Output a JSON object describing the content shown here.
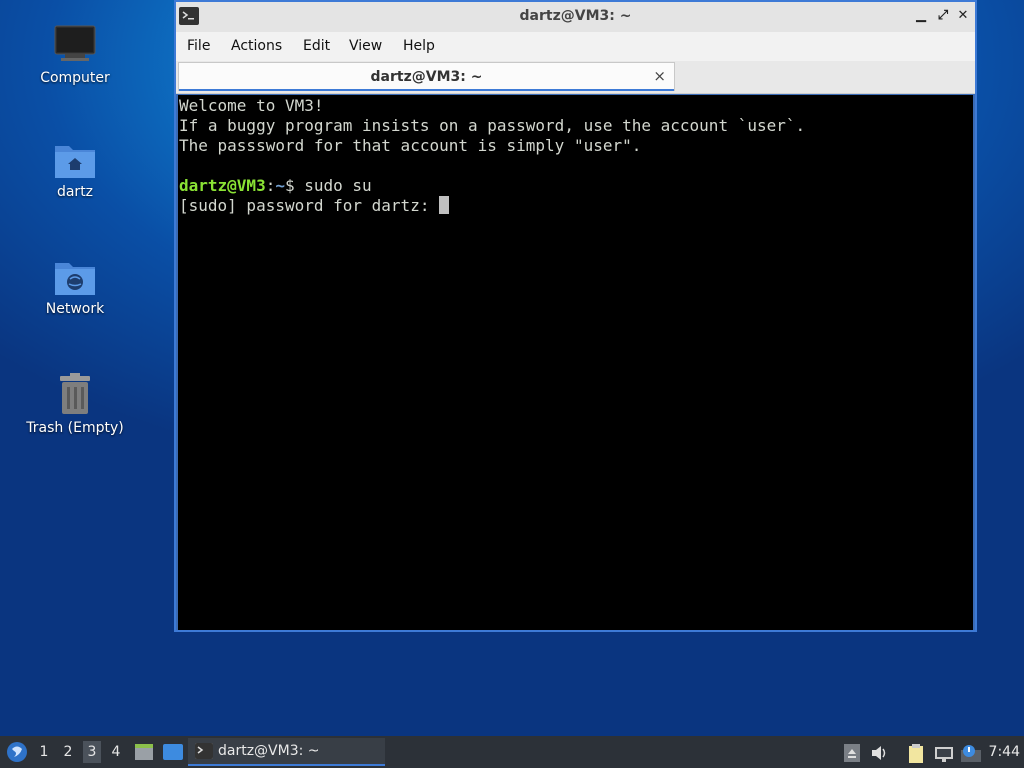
{
  "desktop": {
    "icons": [
      {
        "label": "Computer"
      },
      {
        "label": "dartz"
      },
      {
        "label": "Network"
      },
      {
        "label": "Trash (Empty)"
      }
    ]
  },
  "window": {
    "title": "dartz@VM3: ~",
    "controls": {
      "minimize": "▁",
      "maximize": "⤢",
      "close": "✕"
    },
    "menu": [
      "File",
      "Actions",
      "Edit",
      "View",
      "Help"
    ],
    "tab": {
      "label": "dartz@VM3: ~",
      "close": "×"
    },
    "terminal": {
      "lines": [
        "Welcome to VM3!",
        "If a buggy program insists on a password, use the account `user`.",
        "The passsword for that account is simply \"user\".",
        ""
      ],
      "prompt_user": "dartz@VM3",
      "prompt_sep": ":",
      "prompt_path": "~",
      "prompt_symbol": "$ ",
      "command": "sudo su",
      "sudo_prompt": "[sudo] password for dartz: "
    }
  },
  "taskbar": {
    "workspaces": [
      "1",
      "2",
      "3",
      "4"
    ],
    "active_workspace": "3",
    "task_label": "dartz@VM3: ~",
    "clock": "7:44"
  },
  "colors": {
    "accent": "#3d7ad6",
    "prompt_user": "#8ae234",
    "prompt_path": "#729fcf"
  }
}
